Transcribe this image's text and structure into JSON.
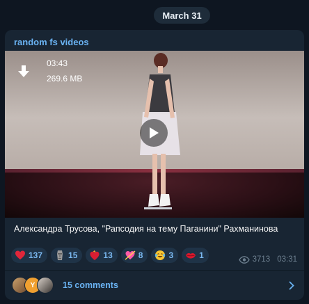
{
  "date_separator": "March 31",
  "post": {
    "channel_name": "random fs videos",
    "video": {
      "duration": "03:43",
      "file_size": "269.6 MB",
      "download_icon": "download-arrow-icon",
      "play_icon": "play-icon"
    },
    "caption": "Александра Трусова, \"Рапсодия на тему Паганини\" Рахманинова",
    "reactions": [
      {
        "icon": "red-heart-emoji",
        "count": "137"
      },
      {
        "icon": "moai-emoji",
        "count": "15"
      },
      {
        "icon": "heart-on-fire-emoji",
        "count": "13"
      },
      {
        "icon": "heart-with-arrow-emoji",
        "count": "8"
      },
      {
        "icon": "face-with-tears-of-joy-emoji",
        "count": "3"
      },
      {
        "icon": "kiss-lips-emoji",
        "count": "1"
      }
    ],
    "views": "3713",
    "time": "03:31",
    "comments": {
      "label": "15 comments",
      "avatar_initial": "Y"
    }
  },
  "colors": {
    "background": "#0e1621",
    "bubble": "#182533",
    "accent": "#6ab3f3",
    "reaction_bg": "#1f3347"
  }
}
